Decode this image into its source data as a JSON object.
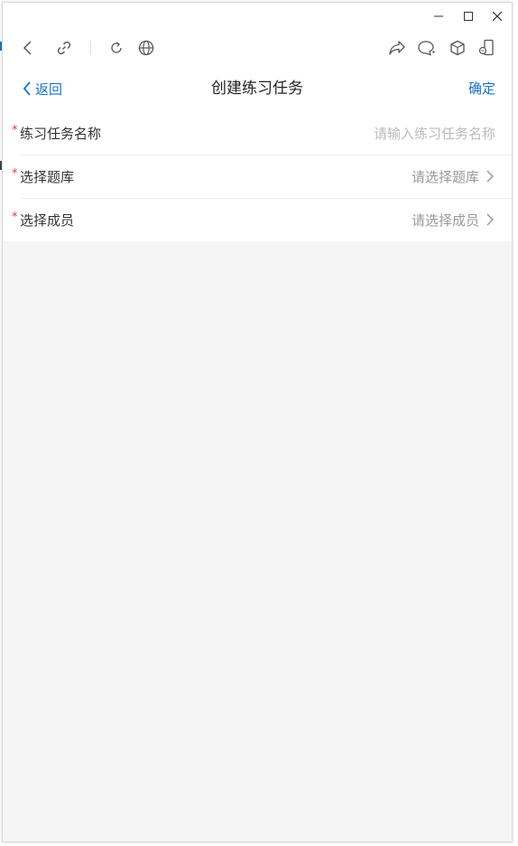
{
  "window_controls": {
    "minimize": "minimize-icon",
    "maximize": "maximize-icon",
    "close": "close-icon"
  },
  "toolbar": {
    "icons": [
      "back-icon",
      "link-icon",
      "refresh-icon",
      "globe-icon",
      "share-icon",
      "chat-icon",
      "cube-icon",
      "phone-icon"
    ]
  },
  "nav": {
    "back_label": "返回",
    "title": "创建练习任务",
    "confirm_label": "确定"
  },
  "form": {
    "task_name": {
      "required_mark": "*",
      "label": "练习任务名称",
      "placeholder": "请输入练习任务名称"
    },
    "question_bank": {
      "required_mark": "*",
      "label": "选择题库",
      "placeholder": "请选择题库"
    },
    "members": {
      "required_mark": "*",
      "label": "选择成员",
      "placeholder": "请选择成员"
    }
  },
  "colors": {
    "accent": "#1a73c9",
    "required": "#e0393e",
    "background": "#f5f5f5"
  }
}
